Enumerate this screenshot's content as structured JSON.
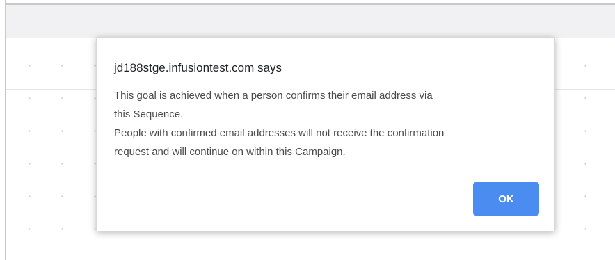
{
  "dialog": {
    "title": "jd188stge.infusiontest.com says",
    "message_lines": [
      "This goal is achieved when a person confirms their email address via",
      "this Sequence.",
      "People with confirmed email addresses will not receive the confirmation",
      "request and will continue on within this Campaign."
    ],
    "ok_label": "OK",
    "accent_color": "#4a8cf0"
  }
}
